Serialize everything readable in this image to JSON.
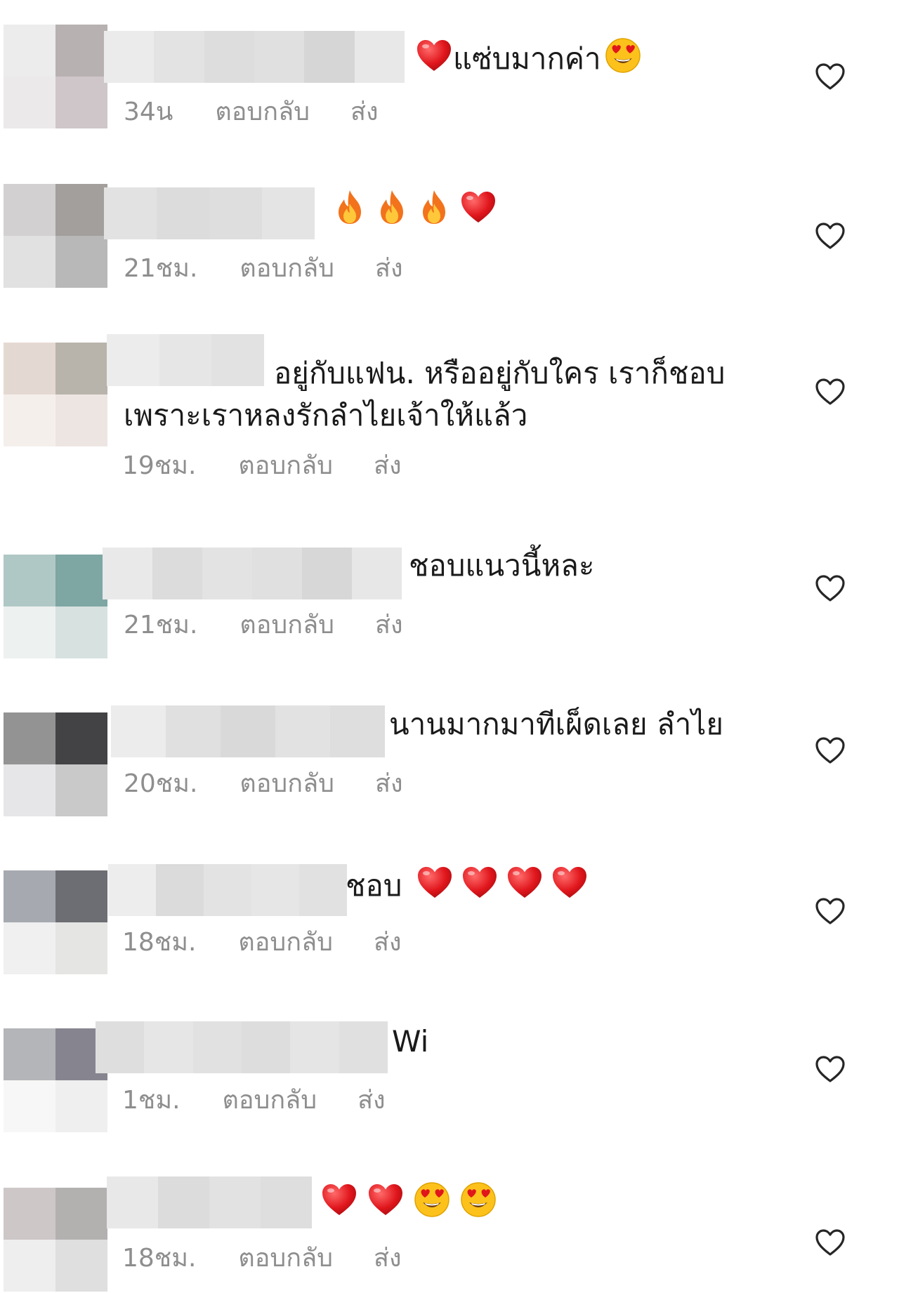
{
  "comments": [
    {
      "text": "แซ่บมากค่า",
      "time": "34น",
      "reply": "ตอบกลับ",
      "send": "ส่ง",
      "avatar": [
        "#ececec",
        "#b8b1b1",
        "#ece9eb",
        "#cec6c8"
      ],
      "name_blur": [
        "#ebebeb",
        "#e3e3e3",
        "#dddddd",
        "#e0e0e0",
        "#d6d6d6",
        "#e8e8e8"
      ]
    },
    {
      "text": "",
      "time": "21ชม.",
      "reply": "ตอบกลับ",
      "send": "ส่ง",
      "avatar": [
        "#d2d0d0",
        "#a29f9d",
        "#e1e1e1",
        "#b9b8b9"
      ],
      "name_blur": [
        "#e2e2e2",
        "#dcdcdc",
        "#dedede",
        "#e4e4e4"
      ]
    },
    {
      "text": "อยู่กับแฟน. หรืออยู่กับใคร เราก็ชอบ",
      "text2": "เพราะเราหลงรักลำไยเจ้าให้แล้ว",
      "time": "19ชม.",
      "reply": "ตอบกลับ",
      "send": "ส่ง",
      "avatar": [
        "#e4d9d2",
        "#b8b3ab",
        "#f5efec",
        "#ede5e2"
      ],
      "name_blur": [
        "#ececec",
        "#e6e6e6",
        "#e2e2e2"
      ]
    },
    {
      "text": "ชอบแนวนี้หละ",
      "time": "21ชม.",
      "reply": "ตอบกลับ",
      "send": "ส่ง",
      "avatar": [
        "#b0c8c5",
        "#7ea6a3",
        "#edf1f0",
        "#d6e1e0"
      ],
      "name_blur": [
        "#e9e9e9",
        "#dcdcdc",
        "#e3e3e3",
        "#e0e0e0",
        "#d7d7d7",
        "#e7e7e7"
      ]
    },
    {
      "text": "นานมากมาทีเผ็ดเลย ลำไย",
      "time": "20ชม.",
      "reply": "ตอบกลับ",
      "send": "ส่ง",
      "avatar": [
        "#939394",
        "#434244",
        "#e6e6e8",
        "#c9c9ca"
      ],
      "name_blur": [
        "#ececec",
        "#e0e0e0",
        "#d9d9d9",
        "#e2e2e2",
        "#dedede"
      ]
    },
    {
      "text": "ชอบ",
      "time": "18ชม.",
      "reply": "ตอบกลับ",
      "send": "ส่ง",
      "avatar": [
        "#a6a9b0",
        "#6d6e73",
        "#eff0ef",
        "#e5e5e3"
      ],
      "name_blur": [
        "#ededed",
        "#dbdbdb",
        "#e3e3e3",
        "#e6e6e6",
        "#e1e1e1"
      ]
    },
    {
      "text": "Wi",
      "time": "1ชม.",
      "reply": "ตอบกลับ",
      "send": "ส่ง",
      "avatar": [
        "#b4b5b9",
        "#86858f",
        "#f7f7f7",
        "#efefef"
      ],
      "name_blur": [
        "#dedede",
        "#e6e6e6",
        "#e1e1e1",
        "#dddddd",
        "#e5e5e5",
        "#e0e0e0"
      ]
    },
    {
      "text": "",
      "time": "18ชม.",
      "reply": "ตอบกลับ",
      "send": "ส่ง",
      "avatar": [
        "#cdc7c8",
        "#b3b0b0",
        "#eeeeee",
        "#dfdfdf"
      ],
      "name_blur": [
        "#e8e8e8",
        "#dcdcdc",
        "#e2e2e2",
        "#dedede"
      ]
    }
  ],
  "icons": {
    "like": "heart-outline-icon",
    "heart": "red-heart-emoji",
    "fire": "fire-emoji",
    "smile": "heart-eyes-emoji"
  },
  "colors": {
    "like_stroke": "#262626",
    "meta": "#8e8e8e",
    "emoji_heart": "#e0161c"
  }
}
